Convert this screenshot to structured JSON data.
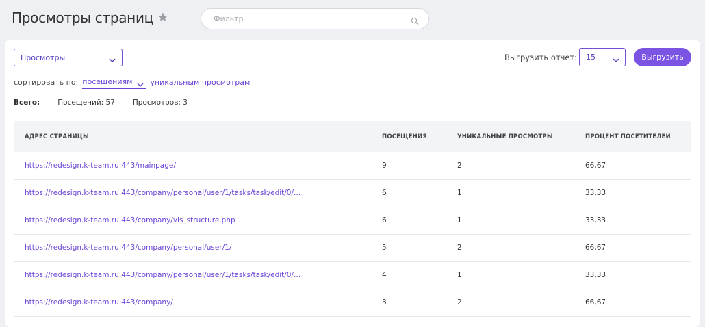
{
  "header": {
    "title": "Просмотры страниц",
    "favorite_icon": "star-icon"
  },
  "filter": {
    "placeholder": "Фильтр",
    "icon": "search-icon"
  },
  "toolbar": {
    "view_select": "Просмотры",
    "export_label": "Выгрузить отчет:",
    "count_select": "15",
    "export_button": "Выгрузить"
  },
  "sort": {
    "label": "сортировать по:",
    "active": "посещениям",
    "other": "уникальным просмотрам"
  },
  "totals": {
    "label": "Всего:",
    "visits": "Посещений: 57",
    "views": "Просмотров: 3"
  },
  "table": {
    "columns": [
      "АДРЕС СТРАНИЦЫ",
      "ПОСЕЩЕНИЯ",
      "УНИКАЛЬНЫЕ ПРОСМОТРЫ",
      "ПРОЦЕНТ ПОСЕТИТЕЛЕЙ"
    ],
    "rows": [
      {
        "url": "https://redesign.k-team.ru:443/mainpage/",
        "visits": "9",
        "unique": "2",
        "percent": "66,67"
      },
      {
        "url": "https://redesign.k-team.ru:443/company/personal/user/1/tasks/task/edit/0/...",
        "visits": "6",
        "unique": "1",
        "percent": "33,33"
      },
      {
        "url": "https://redesign.k-team.ru:443/company/vis_structure.php",
        "visits": "6",
        "unique": "1",
        "percent": "33,33"
      },
      {
        "url": "https://redesign.k-team.ru:443/company/personal/user/1/",
        "visits": "5",
        "unique": "2",
        "percent": "66,67"
      },
      {
        "url": "https://redesign.k-team.ru:443/company/personal/user/1/tasks/task/edit/0/...",
        "visits": "4",
        "unique": "1",
        "percent": "33,33"
      },
      {
        "url": "https://redesign.k-team.ru:443/company/",
        "visits": "3",
        "unique": "2",
        "percent": "66,67"
      }
    ]
  },
  "colors": {
    "accent": "#7c54e4",
    "link": "#6a44d6",
    "background": "#eef0f3"
  }
}
